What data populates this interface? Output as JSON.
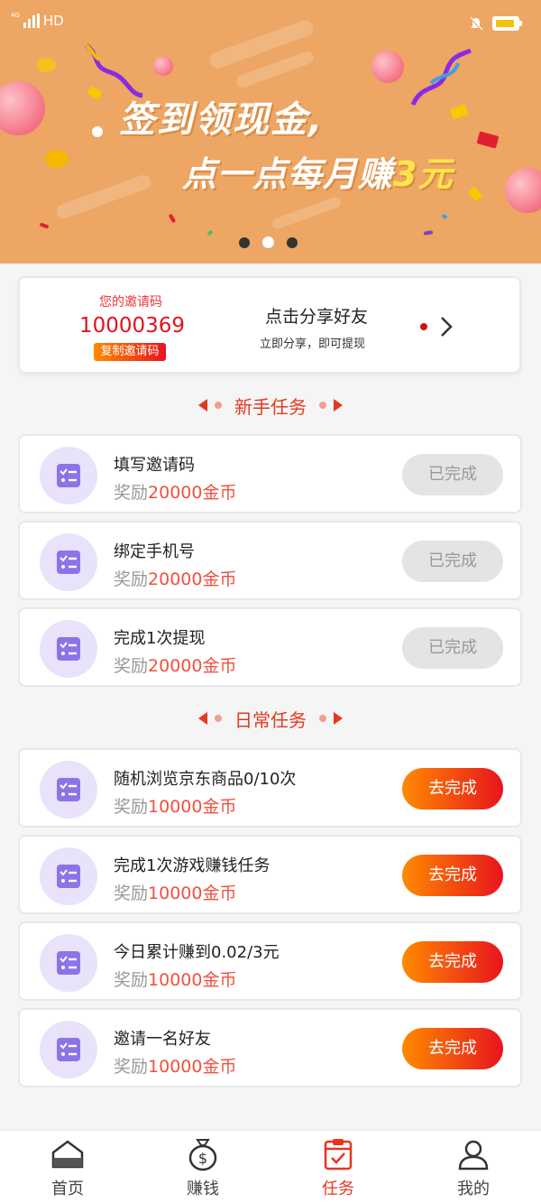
{
  "status_bar": {
    "signal": "4G",
    "network": "HD"
  },
  "banner": {
    "headline_line1": "签到领现金,",
    "headline_line2_prefix": "点一点每月赚",
    "headline_line2_highlight": "3元",
    "slides_total": 3,
    "active_slide": 2
  },
  "invite": {
    "label": "您的邀请码",
    "code": "10000369",
    "copy_label": "复制邀请码",
    "share_title": "点击分享好友",
    "share_subtitle": "立即分享，即可提现"
  },
  "sections": {
    "newbie_title": "新手任务",
    "daily_title": "日常任务"
  },
  "newbie_tasks": [
    {
      "title": "填写邀请码",
      "reward_prefix": "奖励",
      "reward_amount": "20000金币",
      "button": "已完成",
      "status": "done"
    },
    {
      "title": "绑定手机号",
      "reward_prefix": "奖励",
      "reward_amount": "20000金币",
      "button": "已完成",
      "status": "done"
    },
    {
      "title": "完成1次提现",
      "reward_prefix": "奖励",
      "reward_amount": "20000金币",
      "button": "已完成",
      "status": "done"
    }
  ],
  "daily_tasks": [
    {
      "title": "随机浏览京东商品0/10次",
      "reward_prefix": "奖励",
      "reward_amount": "10000金币",
      "button": "去完成",
      "status": "todo"
    },
    {
      "title": "完成1次游戏赚钱任务",
      "reward_prefix": "奖励",
      "reward_amount": "10000金币",
      "button": "去完成",
      "status": "todo"
    },
    {
      "title": "今日累计赚到0.02/3元",
      "reward_prefix": "奖励",
      "reward_amount": "10000金币",
      "button": "去完成",
      "status": "todo"
    },
    {
      "title": "邀请一名好友",
      "reward_prefix": "奖励",
      "reward_amount": "10000金币",
      "button": "去完成",
      "status": "todo"
    }
  ],
  "bottom_nav": [
    {
      "label": "首页",
      "icon": "home-icon",
      "active": false
    },
    {
      "label": "赚钱",
      "icon": "money-bag-icon",
      "active": false
    },
    {
      "label": "任务",
      "icon": "task-clipboard-icon",
      "active": true
    },
    {
      "label": "我的",
      "icon": "user-icon",
      "active": false
    }
  ],
  "colors": {
    "banner_bg": "#eda663",
    "accent_red": "#e5381e",
    "button_gradient_start": "#ff8a00",
    "button_gradient_end": "#e8141e",
    "task_icon_bg": "#e8e2fa",
    "task_icon_fg": "#8c74e8"
  }
}
